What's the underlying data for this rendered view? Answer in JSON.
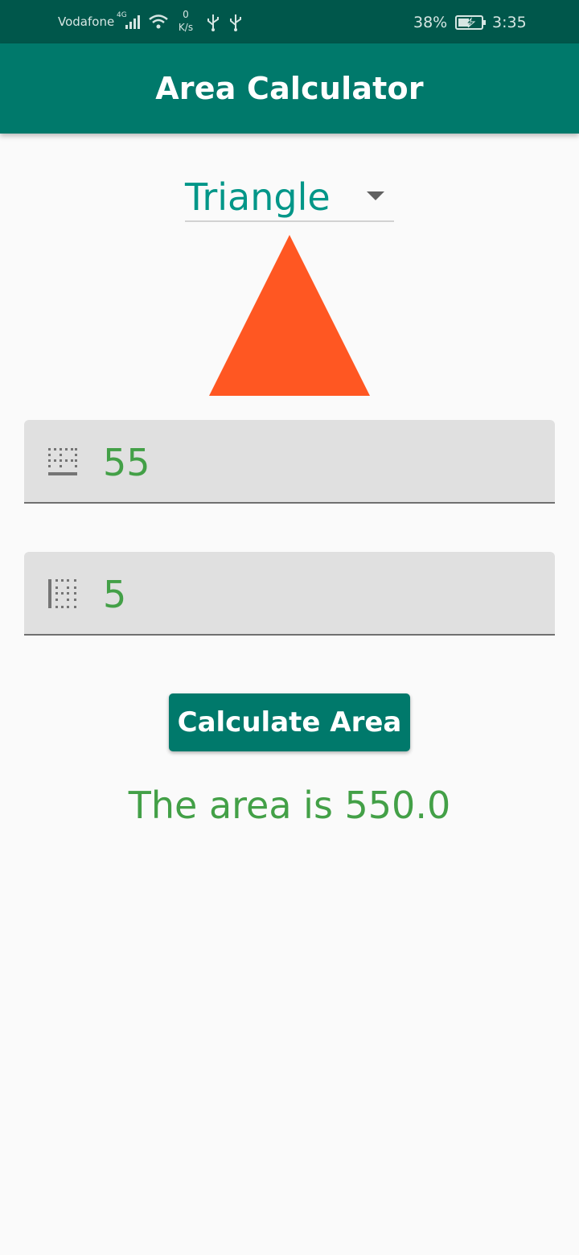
{
  "status_bar": {
    "carrier": "Vodafone",
    "network_type": "4G",
    "speed_value": "0",
    "speed_unit": "K/s",
    "battery_percent": "38%",
    "time": "3:35"
  },
  "app_bar": {
    "title": "Area Calculator"
  },
  "shape_selector": {
    "selected": "Triangle"
  },
  "shape_image": {
    "shape": "triangle",
    "color": "#ff5722"
  },
  "inputs": {
    "base": {
      "value": "55"
    },
    "height": {
      "value": "5"
    }
  },
  "button": {
    "label": "Calculate Area"
  },
  "result": {
    "text": "The area is 550.0"
  },
  "colors": {
    "status_bar": "#00574b",
    "app_bar": "#00796b",
    "accent": "#009688",
    "input_text": "#43a047",
    "shape": "#ff5722"
  }
}
